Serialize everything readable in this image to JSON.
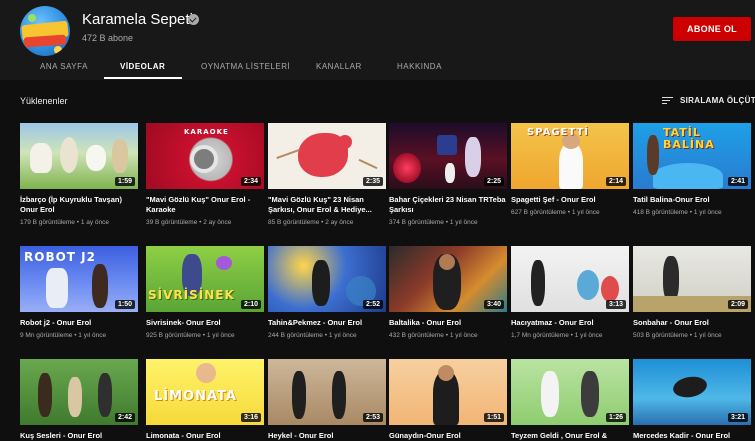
{
  "channel": {
    "name": "Karamela Sepeti",
    "subscribers": "472 B abone",
    "subscribe_label": "ABONE OL",
    "colors": {
      "subscribe": "#cc0000",
      "background": "#181818"
    }
  },
  "tabs": [
    {
      "label": "ANA SAYFA"
    },
    {
      "label": "VİDEOLAR"
    },
    {
      "label": "OYNATMA LİSTELERİ"
    },
    {
      "label": "KANALLAR"
    },
    {
      "label": "HAKKINDA"
    }
  ],
  "active_tab": "VİDEOLAR",
  "section": {
    "title": "Yüklenenler",
    "sort_label": "SIRALAMA ÖLÇÜTÜ",
    "sort_icon": "sort-icon"
  },
  "videos": [
    {
      "title": "İzbarço (İp Kuyruklu Tavşan) Onur Erol",
      "meta": "179 B görüntüleme • 1 ay önce",
      "duration": "1:59",
      "thumb_text": ""
    },
    {
      "title": "\"Mavi Gözlü Kuş\" Onur Erol - Karaoke",
      "meta": "39 B görüntüleme • 2 ay önce",
      "duration": "2:34",
      "thumb_text": "KARAOKE"
    },
    {
      "title": "\"Mavi Gözlü Kuş\" 23 Nisan Şarkısı, Onur Erol & Hediye...",
      "meta": "85 B görüntüleme • 2 ay önce",
      "duration": "2:35",
      "thumb_text": ""
    },
    {
      "title": "Bahar Çiçekleri 23 Nisan TRTeba Şarkısı",
      "meta": "374 B görüntüleme • 1 yıl önce",
      "duration": "2:25",
      "thumb_text": ""
    },
    {
      "title": "Spagetti Şef - Onur Erol",
      "meta": "627 B görüntüleme • 1 yıl önce",
      "duration": "2:14",
      "thumb_text": "SPAGETTİ"
    },
    {
      "title": "Tatil Balina-Onur Erol",
      "meta": "418 B görüntüleme • 1 yıl önce",
      "duration": "2:41",
      "thumb_text": "TATİL BALİNA"
    },
    {
      "title": "Robot j2 - Onur Erol",
      "meta": "9 Mn görüntüleme • 1 yıl önce",
      "duration": "1:50",
      "thumb_text": "ROBOT J2"
    },
    {
      "title": "Sivrisinek- Onur Erol",
      "meta": "925 B görüntüleme • 1 yıl önce",
      "duration": "2:10",
      "thumb_text": "SİVRİSİNEK"
    },
    {
      "title": "Tahin&Pekmez - Onur Erol",
      "meta": "244 B görüntüleme • 1 yıl önce",
      "duration": "2:52",
      "thumb_text": ""
    },
    {
      "title": "Baltalika - Onur Erol",
      "meta": "432 B görüntüleme • 1 yıl önce",
      "duration": "3:40",
      "thumb_text": ""
    },
    {
      "title": "Hacıyatmaz - Onur Erol",
      "meta": "1,7 Mn görüntüleme • 1 yıl önce",
      "duration": "3:13",
      "thumb_text": ""
    },
    {
      "title": "Sonbahar - Onur Erol",
      "meta": "503 B görüntüleme • 1 yıl önce",
      "duration": "2:09",
      "thumb_text": ""
    },
    {
      "title": "Kuş Sesleri - Onur Erol",
      "meta": "",
      "duration": "2:42",
      "thumb_text": ""
    },
    {
      "title": "Limonata - Onur Erol",
      "meta": "",
      "duration": "3:16",
      "thumb_text": "LİMONATA"
    },
    {
      "title": "Heykel - Onur Erol",
      "meta": "",
      "duration": "2:53",
      "thumb_text": ""
    },
    {
      "title": "Günaydın-Onur Erol",
      "meta": "",
      "duration": "1:51",
      "thumb_text": ""
    },
    {
      "title": "Teyzem Geldi , Onur Erol &",
      "meta": "",
      "duration": "1:26",
      "thumb_text": ""
    },
    {
      "title": "Mercedes Kadir - Onur Erol",
      "meta": "",
      "duration": "3:21",
      "thumb_text": ""
    }
  ]
}
